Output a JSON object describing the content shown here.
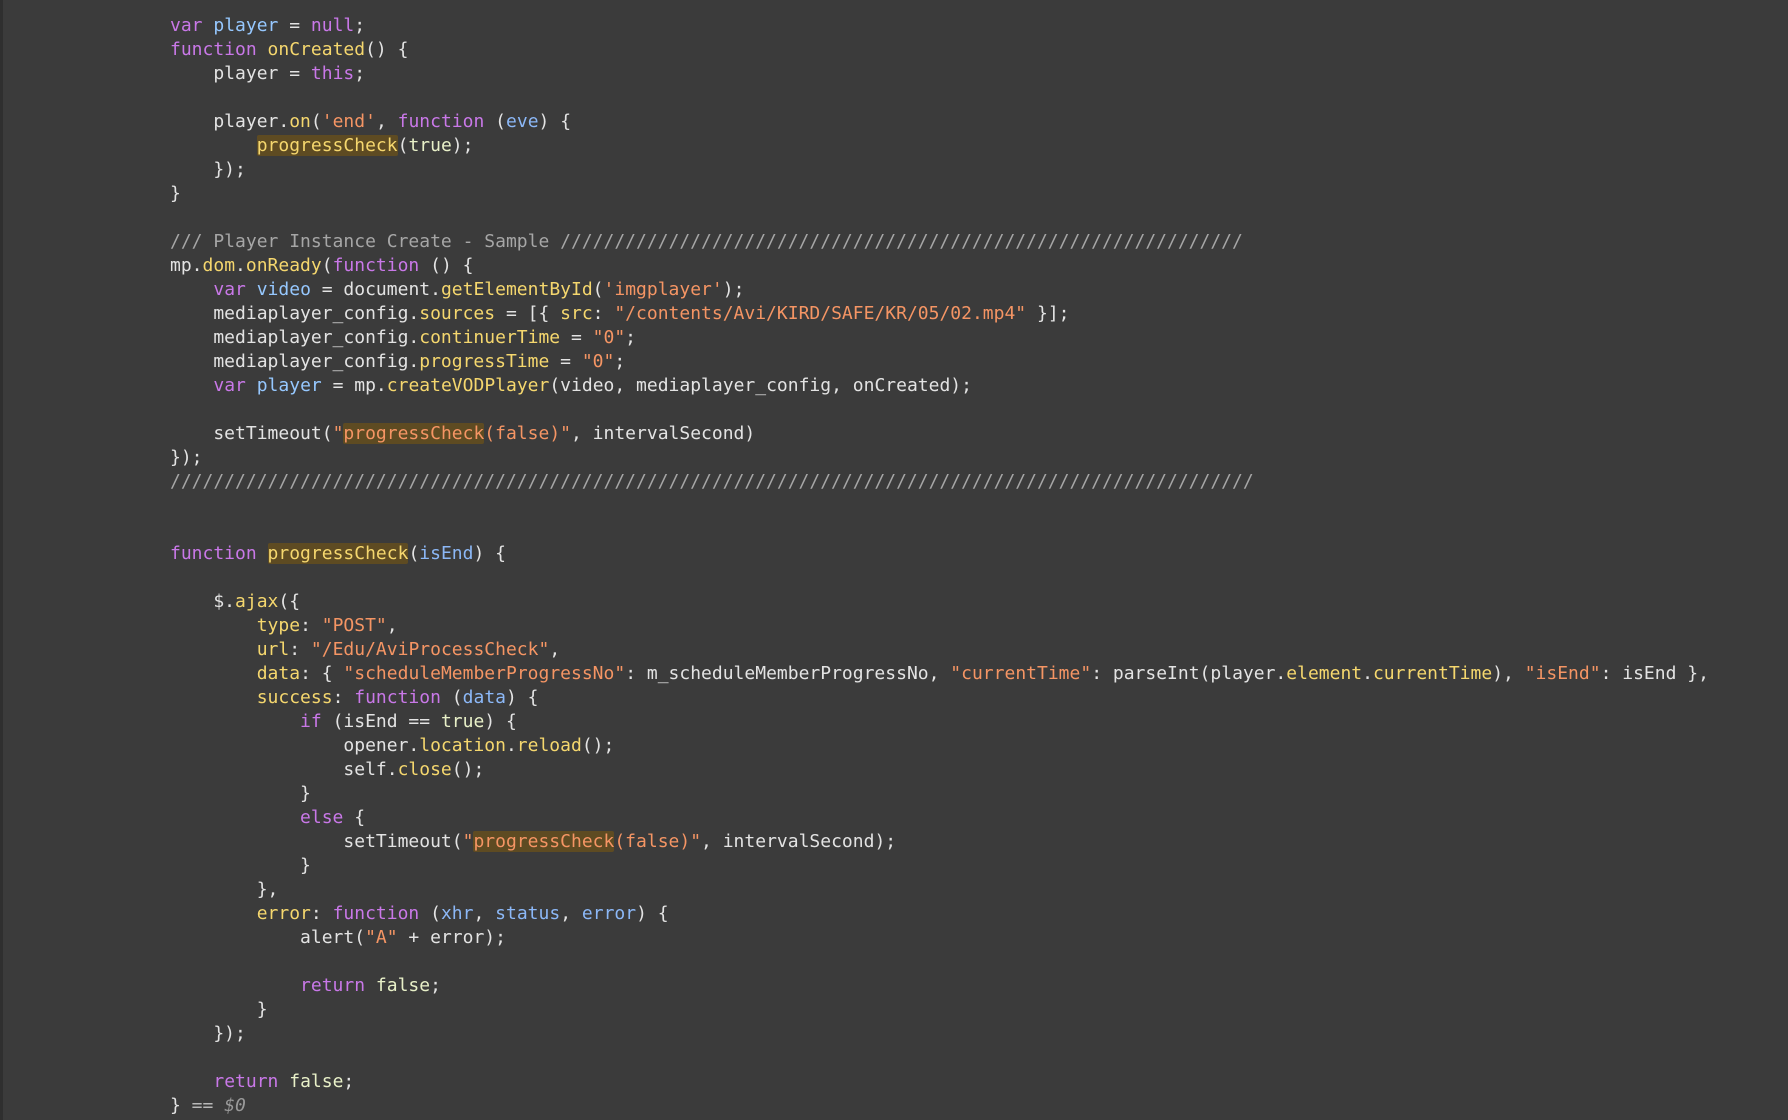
{
  "code_lines": [
    [
      {
        "t": "var",
        "c": "kw"
      },
      {
        "t": " ",
        "c": "txt"
      },
      {
        "t": "player",
        "c": "var"
      },
      {
        "t": " = ",
        "c": "txt"
      },
      {
        "t": "null",
        "c": "kw"
      },
      {
        "t": ";",
        "c": "txt"
      }
    ],
    [
      {
        "t": "function",
        "c": "kw"
      },
      {
        "t": " ",
        "c": "txt"
      },
      {
        "t": "onCreated",
        "c": "fn"
      },
      {
        "t": "() {",
        "c": "txt"
      }
    ],
    [
      {
        "t": "    player = ",
        "c": "txt"
      },
      {
        "t": "this",
        "c": "kw"
      },
      {
        "t": ";",
        "c": "txt"
      }
    ],
    [],
    [
      {
        "t": "    player.",
        "c": "txt"
      },
      {
        "t": "on",
        "c": "fn"
      },
      {
        "t": "(",
        "c": "txt"
      },
      {
        "t": "'end'",
        "c": "str"
      },
      {
        "t": ", ",
        "c": "txt"
      },
      {
        "t": "function",
        "c": "kw"
      },
      {
        "t": " (",
        "c": "txt"
      },
      {
        "t": "eve",
        "c": "param"
      },
      {
        "t": ") {",
        "c": "txt"
      }
    ],
    [
      {
        "t": "        ",
        "c": "txt"
      },
      {
        "t": "progressCheck",
        "c": "fn",
        "hl": true
      },
      {
        "t": "(",
        "c": "txt"
      },
      {
        "t": "true",
        "c": "val"
      },
      {
        "t": ");",
        "c": "txt"
      }
    ],
    [
      {
        "t": "    });",
        "c": "txt"
      }
    ],
    [
      {
        "t": "}",
        "c": "txt"
      }
    ],
    [],
    [
      {
        "t": "/// Player Instance Create - Sample ///////////////////////////////////////////////////////////////",
        "c": "cmt"
      }
    ],
    [
      {
        "t": "mp.",
        "c": "txt"
      },
      {
        "t": "dom",
        "c": "prop"
      },
      {
        "t": ".",
        "c": "txt"
      },
      {
        "t": "onReady",
        "c": "fn"
      },
      {
        "t": "(",
        "c": "txt"
      },
      {
        "t": "function",
        "c": "kw"
      },
      {
        "t": " () {",
        "c": "txt"
      }
    ],
    [
      {
        "t": "    ",
        "c": "txt"
      },
      {
        "t": "var",
        "c": "kw"
      },
      {
        "t": " ",
        "c": "txt"
      },
      {
        "t": "video",
        "c": "var"
      },
      {
        "t": " = document.",
        "c": "txt"
      },
      {
        "t": "getElementById",
        "c": "fn"
      },
      {
        "t": "(",
        "c": "txt"
      },
      {
        "t": "'imgplayer'",
        "c": "str"
      },
      {
        "t": ");",
        "c": "txt"
      }
    ],
    [
      {
        "t": "    mediaplayer_config.",
        "c": "txt"
      },
      {
        "t": "sources",
        "c": "prop"
      },
      {
        "t": " = [{ ",
        "c": "txt"
      },
      {
        "t": "src",
        "c": "prop"
      },
      {
        "t": ": ",
        "c": "txt"
      },
      {
        "t": "\"/contents/Avi/KIRD/SAFE/KR/05/02.mp4\"",
        "c": "str"
      },
      {
        "t": " }];",
        "c": "txt"
      }
    ],
    [
      {
        "t": "    mediaplayer_config.",
        "c": "txt"
      },
      {
        "t": "continuerTime",
        "c": "prop"
      },
      {
        "t": " = ",
        "c": "txt"
      },
      {
        "t": "\"0\"",
        "c": "str"
      },
      {
        "t": ";",
        "c": "txt"
      }
    ],
    [
      {
        "t": "    mediaplayer_config.",
        "c": "txt"
      },
      {
        "t": "progressTime",
        "c": "prop"
      },
      {
        "t": " = ",
        "c": "txt"
      },
      {
        "t": "\"0\"",
        "c": "str"
      },
      {
        "t": ";",
        "c": "txt"
      }
    ],
    [
      {
        "t": "    ",
        "c": "txt"
      },
      {
        "t": "var",
        "c": "kw"
      },
      {
        "t": " ",
        "c": "txt"
      },
      {
        "t": "player",
        "c": "var"
      },
      {
        "t": " = mp.",
        "c": "txt"
      },
      {
        "t": "createVODPlayer",
        "c": "fn"
      },
      {
        "t": "(video, mediaplayer_config, onCreated);",
        "c": "txt"
      }
    ],
    [],
    [
      {
        "t": "    setTimeout(",
        "c": "txt"
      },
      {
        "t": "\"",
        "c": "str"
      },
      {
        "t": "progressCheck",
        "c": "str",
        "hl": true
      },
      {
        "t": "(false)\"",
        "c": "str"
      },
      {
        "t": ", intervalSecond)",
        "c": "txt"
      }
    ],
    [
      {
        "t": "});",
        "c": "txt"
      }
    ],
    [
      {
        "t": "////////////////////////////////////////////////////////////////////////////////////////////////////",
        "c": "cmt"
      }
    ],
    [],
    [],
    [
      {
        "t": "function",
        "c": "kw"
      },
      {
        "t": " ",
        "c": "txt"
      },
      {
        "t": "progressCheck",
        "c": "fn",
        "hl": true
      },
      {
        "t": "(",
        "c": "txt"
      },
      {
        "t": "isEnd",
        "c": "param"
      },
      {
        "t": ") {",
        "c": "txt"
      }
    ],
    [],
    [
      {
        "t": "    $.",
        "c": "txt"
      },
      {
        "t": "ajax",
        "c": "fn"
      },
      {
        "t": "({",
        "c": "txt"
      }
    ],
    [
      {
        "t": "        ",
        "c": "txt"
      },
      {
        "t": "type",
        "c": "prop"
      },
      {
        "t": ": ",
        "c": "txt"
      },
      {
        "t": "\"POST\"",
        "c": "str"
      },
      {
        "t": ",",
        "c": "txt"
      }
    ],
    [
      {
        "t": "        ",
        "c": "txt"
      },
      {
        "t": "url",
        "c": "prop"
      },
      {
        "t": ": ",
        "c": "txt"
      },
      {
        "t": "\"/Edu/AviProcessCheck\"",
        "c": "str"
      },
      {
        "t": ",",
        "c": "txt"
      }
    ],
    [
      {
        "t": "        ",
        "c": "txt"
      },
      {
        "t": "data",
        "c": "prop"
      },
      {
        "t": ": { ",
        "c": "txt"
      },
      {
        "t": "\"scheduleMemberProgressNo\"",
        "c": "str"
      },
      {
        "t": ": m_scheduleMemberProgressNo, ",
        "c": "txt"
      },
      {
        "t": "\"currentTime\"",
        "c": "str"
      },
      {
        "t": ": parseInt(player.",
        "c": "txt"
      },
      {
        "t": "element",
        "c": "prop"
      },
      {
        "t": ".",
        "c": "txt"
      },
      {
        "t": "currentTime",
        "c": "prop"
      },
      {
        "t": "), ",
        "c": "txt"
      },
      {
        "t": "\"isEnd\"",
        "c": "str"
      },
      {
        "t": ": isEnd },",
        "c": "txt"
      }
    ],
    [
      {
        "t": "        ",
        "c": "txt"
      },
      {
        "t": "success",
        "c": "prop"
      },
      {
        "t": ": ",
        "c": "txt"
      },
      {
        "t": "function",
        "c": "kw"
      },
      {
        "t": " (",
        "c": "txt"
      },
      {
        "t": "data",
        "c": "param"
      },
      {
        "t": ") {",
        "c": "txt"
      }
    ],
    [
      {
        "t": "            ",
        "c": "txt"
      },
      {
        "t": "if",
        "c": "kw"
      },
      {
        "t": " (isEnd == ",
        "c": "txt"
      },
      {
        "t": "true",
        "c": "val"
      },
      {
        "t": ") {",
        "c": "txt"
      }
    ],
    [
      {
        "t": "                opener.",
        "c": "txt"
      },
      {
        "t": "location",
        "c": "prop"
      },
      {
        "t": ".",
        "c": "txt"
      },
      {
        "t": "reload",
        "c": "fn"
      },
      {
        "t": "();",
        "c": "txt"
      }
    ],
    [
      {
        "t": "                self.",
        "c": "txt"
      },
      {
        "t": "close",
        "c": "fn"
      },
      {
        "t": "();",
        "c": "txt"
      }
    ],
    [
      {
        "t": "            }",
        "c": "txt"
      }
    ],
    [
      {
        "t": "            ",
        "c": "txt"
      },
      {
        "t": "else",
        "c": "kw"
      },
      {
        "t": " {",
        "c": "txt"
      }
    ],
    [
      {
        "t": "                setTimeout(",
        "c": "txt"
      },
      {
        "t": "\"",
        "c": "str"
      },
      {
        "t": "progressCheck",
        "c": "str",
        "hl": true
      },
      {
        "t": "(false)\"",
        "c": "str"
      },
      {
        "t": ", intervalSecond);",
        "c": "txt"
      }
    ],
    [
      {
        "t": "            }",
        "c": "txt"
      }
    ],
    [
      {
        "t": "        },",
        "c": "txt"
      }
    ],
    [
      {
        "t": "        ",
        "c": "txt"
      },
      {
        "t": "error",
        "c": "prop"
      },
      {
        "t": ": ",
        "c": "txt"
      },
      {
        "t": "function",
        "c": "kw"
      },
      {
        "t": " (",
        "c": "txt"
      },
      {
        "t": "xhr",
        "c": "param"
      },
      {
        "t": ", ",
        "c": "txt"
      },
      {
        "t": "status",
        "c": "param"
      },
      {
        "t": ", ",
        "c": "txt"
      },
      {
        "t": "error",
        "c": "param"
      },
      {
        "t": ") {",
        "c": "txt"
      }
    ],
    [
      {
        "t": "            alert(",
        "c": "txt"
      },
      {
        "t": "\"A\"",
        "c": "str"
      },
      {
        "t": " + error);",
        "c": "txt"
      }
    ],
    [],
    [
      {
        "t": "            ",
        "c": "txt"
      },
      {
        "t": "return",
        "c": "kw"
      },
      {
        "t": " ",
        "c": "txt"
      },
      {
        "t": "false",
        "c": "val"
      },
      {
        "t": ";",
        "c": "txt"
      }
    ],
    [
      {
        "t": "        }",
        "c": "txt"
      }
    ],
    [
      {
        "t": "    });",
        "c": "txt"
      }
    ],
    [],
    [
      {
        "t": "    ",
        "c": "txt"
      },
      {
        "t": "return",
        "c": "kw"
      },
      {
        "t": " ",
        "c": "txt"
      },
      {
        "t": "false",
        "c": "val"
      },
      {
        "t": ";",
        "c": "txt"
      }
    ],
    [
      {
        "t": "}",
        "c": "txt"
      },
      {
        "t": " == ",
        "c": "dim"
      },
      {
        "t": "$0",
        "c": "ref"
      }
    ]
  ],
  "colors": {
    "background": "#3b3b3b",
    "keyword": "#c978e8",
    "variable": "#96c8ff",
    "parameter": "#8cb8f7",
    "function": "#f5d76e",
    "string": "#f59564",
    "literal": "#e8f0c8",
    "comment": "#a6a6a6",
    "text": "#e3e3e3",
    "highlight": "#5e4b22"
  }
}
